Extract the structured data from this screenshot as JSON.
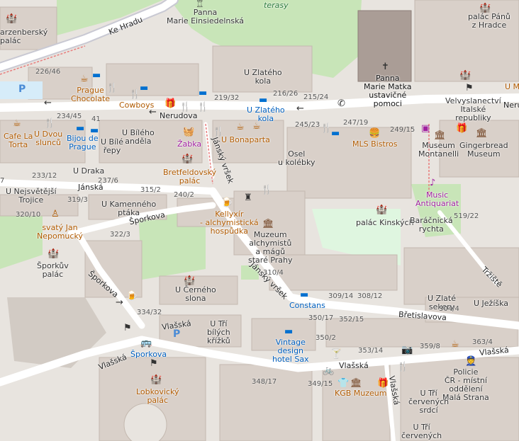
{
  "streets": {
    "ke_hradu": "Ke Hradu",
    "nerudova_left": "Nerudova",
    "nerudova_right": "Nerudo",
    "janska": "Jánská",
    "sporkova_1": "Šporkova",
    "sporkova_2": "Šporkova",
    "jansky_vrsek_1": "Jánský vršek",
    "jansky_vrsek_2": "Jánský vršek",
    "vlasska_1": "Vlašská",
    "vlasska_2": "Vlašská",
    "vlasska_3": "Vlašská",
    "vlasska_4": "Vlašská",
    "vlasska_5": "Vlašská",
    "bretislavova": "Břetislavova",
    "trziste": "Tržiště"
  },
  "places": {
    "schwarzenbersky": "arzenberský\npalác",
    "panna_einsiedelnska": "Panna\nMarie Einsiedelnská",
    "terasy": "terasy",
    "panna_matka": "Panna\nMarie Matka\nustavičné\npomoci",
    "palac_panu_z_hradce": "palác Pánů\nz Hradce",
    "u_m": "U M",
    "u_zlateho_kola": "U Zlatého\nkola",
    "prague_chocolate": "Prague\nChocolate",
    "cowboys": "Cowboys",
    "u_zlateho_kola_hotel": "U Zlatého\nkola",
    "velvyslanectvi": "Velvyslanectví\nItalské\nrepubliky",
    "cafe_la_torta": "Cafe La\nTorta",
    "u_dvou_sluncu": "U Dvou\nslunců",
    "bijou_de_prague": "Bijou de\nPrague",
    "u_bile_repy": "U Bílé\nřepy",
    "u_bileho_andela": "U Bílého\nanděla",
    "zabka": "Žabka",
    "u_bonaparta": "U Bonaparta",
    "mls_bistros": "MLS Bistros",
    "museum_montanelli": "Museum\nMontanelli",
    "gingerbread_museum": "Gingerbread\nMuseum",
    "osel_u_kolebky": "Osel\nu kolébky",
    "u_draka": "U Draka",
    "bretfeldovsky": "Bretfeldovský\npalác",
    "u_nejsvetejsi_trojice": "U Nejsvětější\nTrojice",
    "u_kamenneho_ptaka": "U Kamenného\nptáka",
    "kellyxir": "Kellyxír\n- alchymistická\nhospůdka",
    "muzeum_alchymistu": "Muzeum\nalchymistů\na mágů\nstaré Prahy",
    "music_antiquariat": "Music\nAntiquariat",
    "palac_kinskych": "palác Kinských",
    "baracnicka_rychta": "Baráčnická\nrychta",
    "svaty_jan": "svatý Jan\nNepomucký",
    "sporkuv_palac": "Šporkův\npalác",
    "u_cerneho_slona": "U Černého\nslona",
    "constans": "Constans",
    "u_zlate_sekery": "U Zlaté\nsekery",
    "u_jezisky": "U Ježíška",
    "u_tri_bilych_krizku": "U Tří\nbílých\nkřížků",
    "vintage_design_hotel": "Vintage\ndesign\nhotel Sax",
    "sporkova_stop": "Šporkova",
    "lobkovicky_palac": "Lobkovický\npalác",
    "kgb_muzeum": "KGB Muzeum",
    "policie": "Policie\nČR - místní\noddělení\nMalá Strana",
    "u_tri_cervenych_srdci": "U Tří\nčervených\nsrdcí",
    "u_tri_cervenych": "U Tří\nčervených"
  },
  "house_numbers": [
    "226/46",
    "219/32",
    "216/26",
    "215/24",
    "234/45",
    "41",
    "245/23",
    "247/19",
    "249/15",
    "233/12",
    "237/6",
    "315/2",
    "240/2",
    "319/3",
    "320/10",
    "322/3",
    "519/22",
    "310/4",
    "309/14",
    "308/12",
    "304/4",
    "334/32",
    "350/17",
    "352/15",
    "363/4",
    "350/2",
    "353/14",
    "359/8",
    "348/17",
    "349/15",
    "7"
  ],
  "colors": {
    "building": "#d9d0c9",
    "road": "#ffffff",
    "park": "#c8e5b8",
    "water": "#d6ecf9",
    "church": "#aa9d96",
    "poi_brown": "#b05a00",
    "poi_blue": "#0060c0",
    "poi_purple": "#a020a0"
  }
}
